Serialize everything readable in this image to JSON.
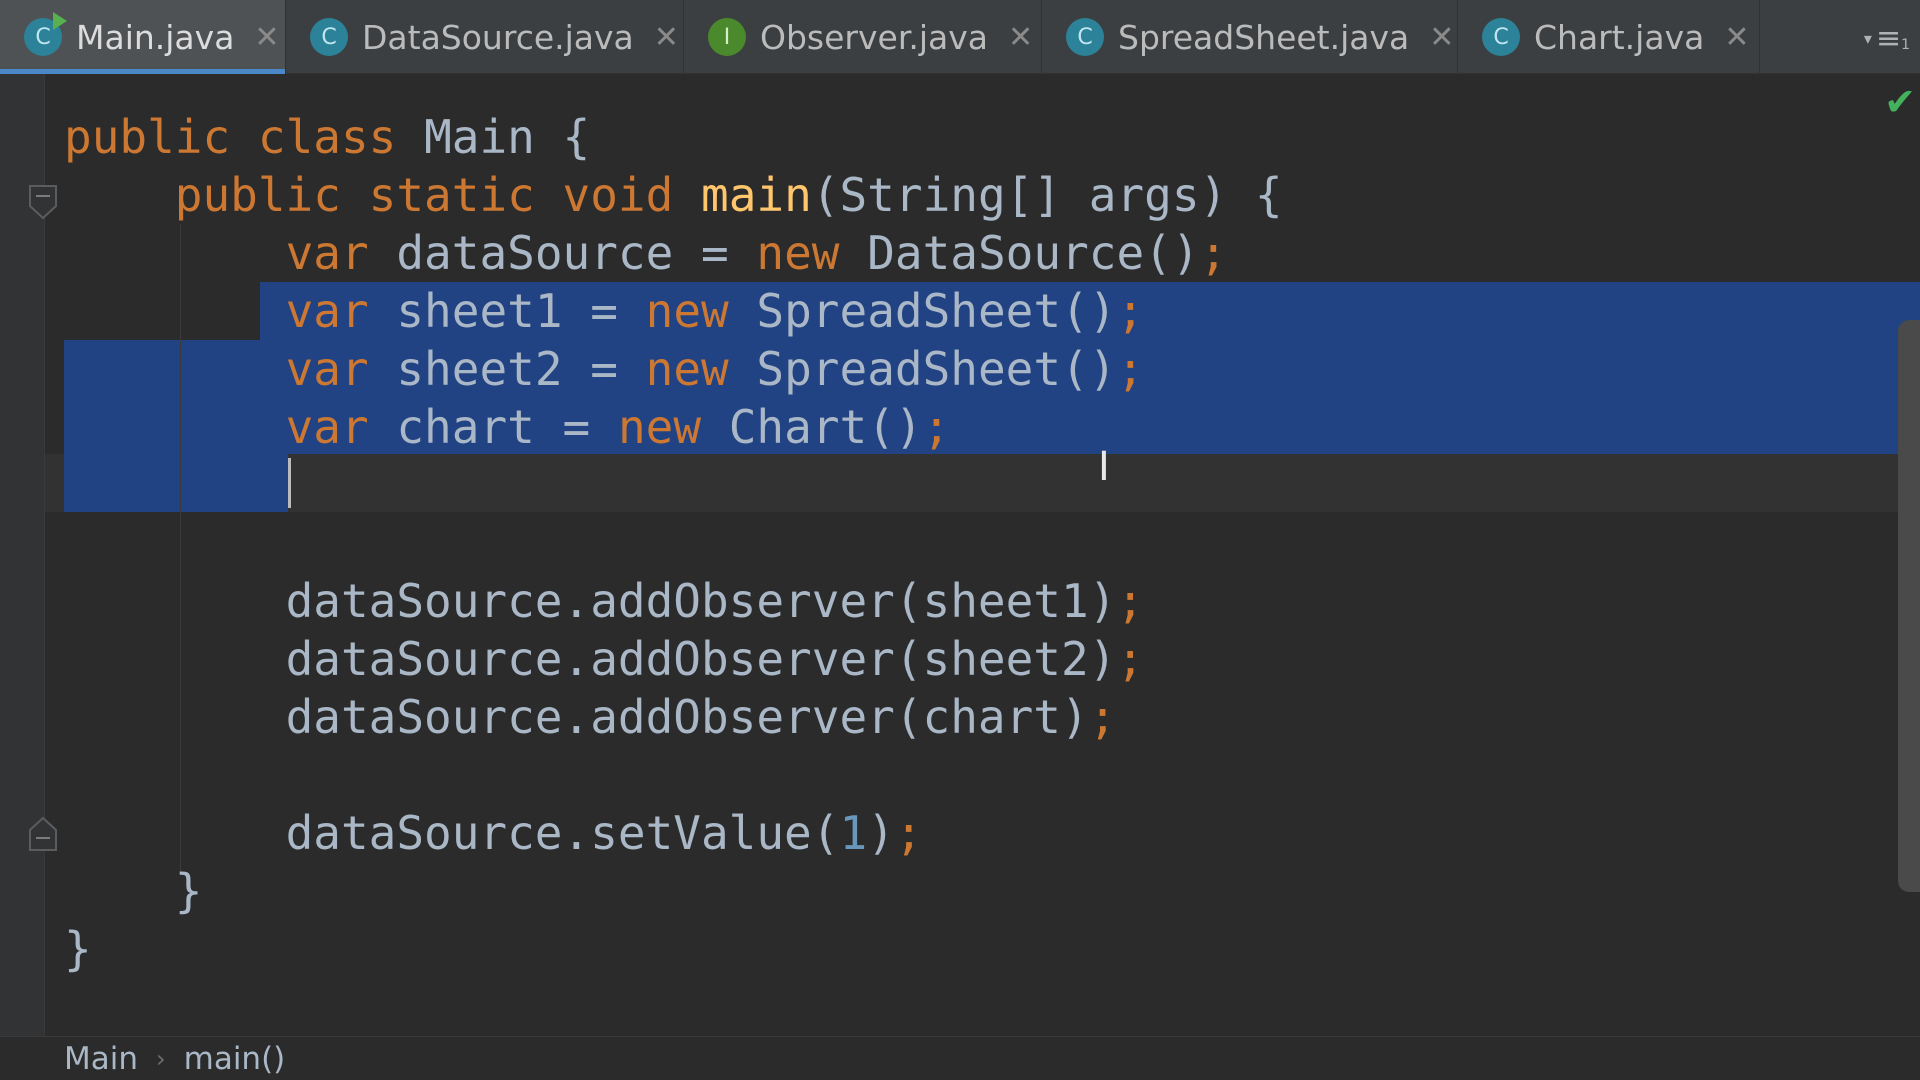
{
  "tabs": [
    {
      "label": "Main.java",
      "icon": "class-icon",
      "icon_letter": "C",
      "active": true
    },
    {
      "label": "DataSource.java",
      "icon": "class-icon",
      "icon_letter": "C",
      "active": false
    },
    {
      "label": "Observer.java",
      "icon": "interface-icon",
      "icon_letter": "I",
      "active": false
    },
    {
      "label": "SpreadSheet.java",
      "icon": "class-icon",
      "icon_letter": "C",
      "active": false
    },
    {
      "label": "Chart.java",
      "icon": "class-icon",
      "icon_letter": "C",
      "active": false
    }
  ],
  "tab_close_glyph": "✕",
  "tab_menu": {
    "arrow": "▾",
    "icon": "≡",
    "count": "1"
  },
  "editor": {
    "code": {
      "l1": {
        "kw1": "public",
        "kw2": "class",
        "name": "Main",
        "brace": "{"
      },
      "l2": {
        "kw1": "public",
        "kw2": "static",
        "kw3": "void",
        "fn": "main",
        "params": "(String[] args)",
        "brace": "{"
      },
      "l3": {
        "kw": "var",
        "text": "dataSource =",
        "new": "new",
        "ctor": "DataSource()",
        "semi": ";"
      },
      "l4": {
        "kw": "var",
        "text": "sheet1 =",
        "new": "new",
        "ctor": "SpreadSheet()",
        "semi": ";"
      },
      "l5": {
        "kw": "var",
        "text": "sheet2 =",
        "new": "new",
        "ctor": "SpreadSheet()",
        "semi": ";"
      },
      "l6": {
        "kw": "var",
        "text": "chart =",
        "new": "new",
        "ctor": "Chart()",
        "semi": ";"
      },
      "l8": {
        "text": "dataSource.addObserver(sheet1)",
        "semi": ";"
      },
      "l9": {
        "text": "dataSource.addObserver(sheet2)",
        "semi": ";"
      },
      "l10": {
        "text": "dataSource.addObserver(chart)",
        "semi": ";"
      },
      "l12": {
        "pre": "dataSource.setValue(",
        "num": "1",
        "post": ")",
        "semi": ";"
      },
      "l13": {
        "brace": "}"
      },
      "l14": {
        "brace": "}"
      }
    },
    "status_icon": "check-icon"
  },
  "breadcrumb": [
    "Main",
    "main()"
  ],
  "breadcrumb_sep": "›",
  "colors": {
    "keyword": "#cc7832",
    "function": "#ffc66d",
    "number": "#6897bb",
    "text": "#a9b7c6",
    "selection": "#214283",
    "background": "#2b2b2b"
  }
}
